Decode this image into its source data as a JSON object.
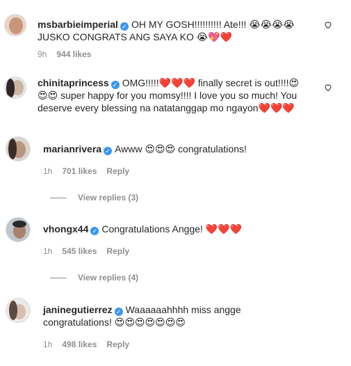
{
  "comments": [
    {
      "username": "msbarbieimperial",
      "text_line1": "OH MY GOSH!!!!!!!!!! Ate!!! 😭😭😭😭",
      "text_line2": "JUSKO CONGRATS ANG SAYA KO 😭💖❤️",
      "time": "9h",
      "likes": "944 likes",
      "reply_label": ""
    },
    {
      "username": "chinitaprincess",
      "text_line1": "OMG!!!!!❤️❤️❤️ finally secret is out!!!!😍",
      "text_line2": "😍😍 super happy for you momsy!!!! I love you so much! You",
      "text_line3": "deserve every blessing na natatanggap mo ngayon❤️❤️❤️",
      "time": "",
      "likes": "",
      "reply_label": ""
    },
    {
      "username": "marianrivera",
      "text_line1": "Awww 😍😍😍 congratulations!",
      "time": "1h",
      "likes": "701 likes",
      "reply_label": "Reply",
      "view_replies": "View replies (3)"
    },
    {
      "username": "vhongx44",
      "text_line1": "Congratulations Angge! ❤️❤️❤️",
      "time": "1h",
      "likes": "545 likes",
      "reply_label": "Reply",
      "view_replies": "View replies (4)"
    },
    {
      "username": "janinegutierrez",
      "text_line1": "Waaaaaahhhh miss angge",
      "text_line2": "congratulations! 😍😍😍😍😍😍😍",
      "time": "1h",
      "likes": "498 likes",
      "reply_label": "Reply"
    }
  ],
  "icons": {
    "verified": "verified-badge-icon",
    "like": "heart-outline-icon"
  },
  "colors": {
    "verified": "#3897f0",
    "secondary_text": "#8e8e8e",
    "heart": "#ed4956"
  }
}
